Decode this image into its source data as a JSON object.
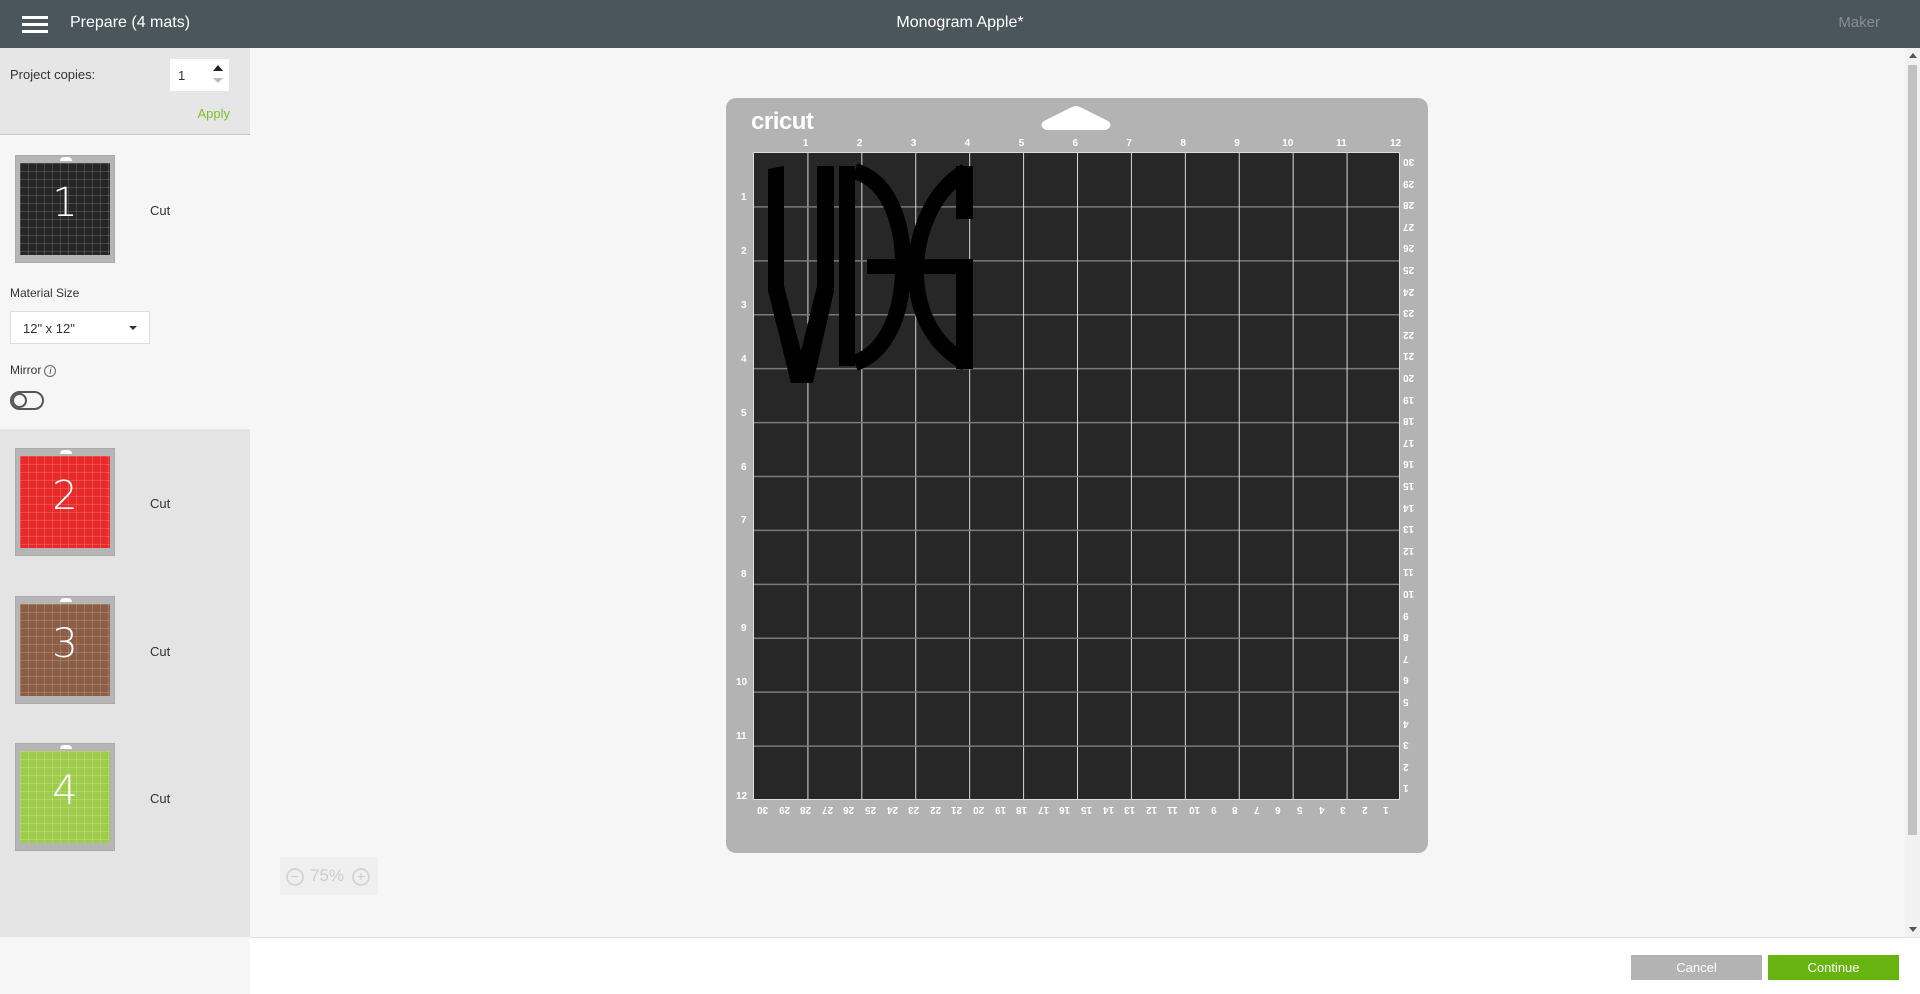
{
  "header": {
    "title": "Prepare (4 mats)",
    "project": "Monogram Apple*",
    "machine": "Maker"
  },
  "sidebar": {
    "copies_label": "Project copies:",
    "copies_value": "1",
    "apply": "Apply",
    "material_size_label": "Material Size",
    "material_size": "12\" x 12\"",
    "mirror_label": "Mirror",
    "mirror_on": false,
    "mats": [
      {
        "number": "1",
        "mode": "Cut",
        "color": "#262626"
      },
      {
        "number": "2",
        "mode": "Cut",
        "color": "#e82a2a"
      },
      {
        "number": "3",
        "mode": "Cut",
        "color": "#8b5e45"
      },
      {
        "number": "4",
        "mode": "Cut",
        "color": "#9fcc4c"
      }
    ]
  },
  "mat": {
    "brand": "cricut",
    "inches": [
      "1",
      "2",
      "3",
      "4",
      "5",
      "6",
      "7",
      "8",
      "9",
      "10",
      "11",
      "12"
    ],
    "cm": [
      "30",
      "29",
      "28",
      "27",
      "26",
      "25",
      "24",
      "23",
      "22",
      "21",
      "20",
      "19",
      "18",
      "17",
      "16",
      "15",
      "14",
      "13",
      "12",
      "11",
      "10",
      "9",
      "8",
      "7",
      "6",
      "5",
      "4",
      "3",
      "2",
      "1"
    ]
  },
  "zoom": {
    "level": "75%",
    "minus": "−",
    "plus": "+"
  },
  "footer": {
    "cancel": "Cancel",
    "continue": "Continue"
  },
  "colors": {
    "header": "#4b555c",
    "accent": "#67b30f"
  }
}
